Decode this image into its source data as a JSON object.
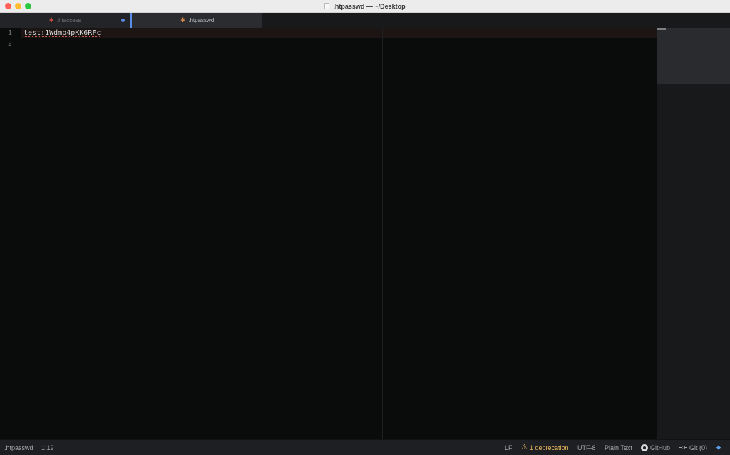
{
  "window": {
    "title": ".htpasswd — ~/Desktop"
  },
  "tabs": [
    {
      "label": ".htaccess",
      "icon": "gear-icon",
      "modified": true,
      "active": false
    },
    {
      "label": ".htpasswd",
      "icon": "gear-icon",
      "modified": false,
      "active": true
    }
  ],
  "editor": {
    "line_numbers": [
      "1",
      "2"
    ],
    "lines": [
      "test:1Wdmb4pKK6RFc",
      ""
    ]
  },
  "status": {
    "filename": ".htpasswd",
    "cursor": "1:19",
    "line_ending": "LF",
    "deprecation": "1 deprecation",
    "encoding": "UTF-8",
    "grammar": "Plain Text",
    "github": "GitHub",
    "git": "Git (0)"
  },
  "colors": {
    "accent": "#5a8ee6",
    "warning": "#e8b85c",
    "close": "#fe5f57",
    "minimize": "#febc2e",
    "maximize": "#28c840"
  }
}
